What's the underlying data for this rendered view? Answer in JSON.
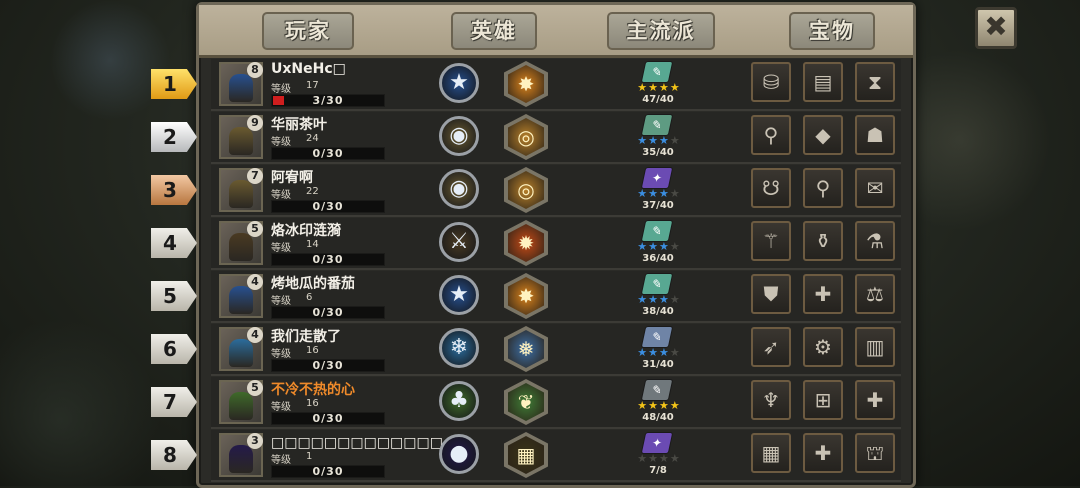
{
  "tabs": [
    "玩家",
    "英雄",
    "主流派",
    "宝物"
  ],
  "close_label": "✖",
  "level_label": "等级",
  "rows": [
    {
      "rank": "1",
      "rank_style": "gold",
      "name": "UxNeHc□",
      "name_color": "white",
      "avatar_level": "8",
      "level": "17",
      "progress": "3/30",
      "progress_ratio": 0.1,
      "faction_icon": "star-icon",
      "faction_color": "#27508f",
      "faction_glyph": "★",
      "hero_icon": "radiant-burst-icon",
      "hero_color": "#d9821c",
      "hero_glyph": "✸",
      "book_color": "#58a892",
      "book_glyph": "✎",
      "stars": 4,
      "star_color": "gold",
      "count": "47/40",
      "treasures": [
        {
          "name": "witch-hat-icon",
          "glyph": "⛁"
        },
        {
          "name": "card-icon",
          "glyph": "▤"
        },
        {
          "name": "hourglass-icon",
          "glyph": "⧗"
        }
      ]
    },
    {
      "rank": "2",
      "rank_style": "silver",
      "name": "华丽茶叶",
      "name_color": "white",
      "avatar_level": "9",
      "level": "24",
      "progress": "0/30",
      "progress_ratio": 0,
      "faction_icon": "coin-icon",
      "faction_color": "#6a5a30",
      "faction_glyph": "◉",
      "hero_icon": "gold-coin-icon",
      "hero_color": "#b7802a",
      "hero_glyph": "◎",
      "book_color": "#5e9b82",
      "book_glyph": "✎",
      "stars": 3,
      "star_color": "blue",
      "count": "35/40",
      "treasures": [
        {
          "name": "telescope-icon",
          "glyph": "⚲"
        },
        {
          "name": "crystal-icon",
          "glyph": "◆"
        },
        {
          "name": "dark-helmet-icon",
          "glyph": "☗"
        }
      ]
    },
    {
      "rank": "3",
      "rank_style": "bronze",
      "name": "阿宥啊",
      "name_color": "white",
      "avatar_level": "7",
      "level": "22",
      "progress": "0/30",
      "progress_ratio": 0,
      "faction_icon": "coin-icon",
      "faction_color": "#6a5a30",
      "faction_glyph": "◉",
      "hero_icon": "gold-coin-icon",
      "hero_color": "#b7802a",
      "hero_glyph": "◎",
      "book_color": "#6b4bb3",
      "book_glyph": "✦",
      "stars": 3,
      "star_color": "blue",
      "count": "37/40",
      "treasures": [
        {
          "name": "red-beast-icon",
          "glyph": "☋"
        },
        {
          "name": "telescope-icon",
          "glyph": "⚲"
        },
        {
          "name": "scroll-icon",
          "glyph": "✉"
        }
      ]
    },
    {
      "rank": "4",
      "rank_style": "plain",
      "name": "烙冰印涟漪",
      "name_color": "white",
      "avatar_level": "5",
      "level": "14",
      "progress": "0/30",
      "progress_ratio": 0,
      "faction_icon": "crossed-blades-icon",
      "faction_color": "#4a3a22",
      "faction_glyph": "⚔",
      "hero_icon": "flame-icon",
      "hero_color": "#c44a16",
      "hero_glyph": "✹",
      "book_color": "#58a892",
      "book_glyph": "✎",
      "stars": 3,
      "star_color": "blue",
      "count": "36/40",
      "treasures": [
        {
          "name": "broom-icon",
          "glyph": "⚚"
        },
        {
          "name": "potion-icon",
          "glyph": "⚱"
        },
        {
          "name": "flask-icon",
          "glyph": "⚗"
        }
      ]
    },
    {
      "rank": "5",
      "rank_style": "plain",
      "name": "烤地瓜的番茄",
      "name_color": "white",
      "avatar_level": "4",
      "level": "6",
      "progress": "0/30",
      "progress_ratio": 0,
      "faction_icon": "star-icon",
      "faction_color": "#27508f",
      "faction_glyph": "★",
      "hero_icon": "radiant-burst-icon",
      "hero_color": "#d9821c",
      "hero_glyph": "✸",
      "book_color": "#58a892",
      "book_glyph": "✎",
      "stars": 3,
      "star_color": "blue",
      "count": "38/40",
      "treasures": [
        {
          "name": "armor-icon",
          "glyph": "⛊"
        },
        {
          "name": "medkit-icon",
          "glyph": "✚"
        },
        {
          "name": "scales-icon",
          "glyph": "⚖"
        }
      ]
    },
    {
      "rank": "6",
      "rank_style": "plain",
      "name": "我们走散了",
      "name_color": "white",
      "avatar_level": "4",
      "level": "16",
      "progress": "0/30",
      "progress_ratio": 0,
      "faction_icon": "frost-icon",
      "faction_color": "#2b6c9c",
      "faction_glyph": "❄",
      "hero_icon": "ice-shard-icon",
      "hero_color": "#3c6fa6",
      "hero_glyph": "❅",
      "book_color": "#6f84a6",
      "book_glyph": "✎",
      "stars": 3,
      "star_color": "blue",
      "count": "31/40",
      "treasures": [
        {
          "name": "spear-icon",
          "glyph": "➶"
        },
        {
          "name": "gear-icon",
          "glyph": "⚙"
        },
        {
          "name": "spellbook-icon",
          "glyph": "▥"
        }
      ]
    },
    {
      "rank": "7",
      "rank_style": "plain",
      "name": "不冷不热的心",
      "name_color": "orange",
      "avatar_level": "5",
      "level": "16",
      "progress": "0/30",
      "progress_ratio": 0,
      "faction_icon": "nature-icon",
      "faction_color": "#3f6a2a",
      "faction_glyph": "♣",
      "hero_icon": "leaf-icon",
      "hero_color": "#3f7c36",
      "hero_glyph": "❦",
      "book_color": "#70787c",
      "book_glyph": "✎",
      "stars": 4,
      "star_color": "gold",
      "count": "48/40",
      "treasures": [
        {
          "name": "goblet-icon",
          "glyph": "♆"
        },
        {
          "name": "gift-box-icon",
          "glyph": "⊞"
        },
        {
          "name": "medkit-icon",
          "glyph": "✚"
        }
      ]
    },
    {
      "rank": "8",
      "rank_style": "plain",
      "name": "□□□□□□□□□□□□□、",
      "name_color": "white",
      "avatar_level": "3",
      "level": "1",
      "progress": "0/30",
      "progress_ratio": 0,
      "faction_icon": "dark-orb-icon",
      "faction_color": "#241a4a",
      "faction_glyph": "●",
      "hero_icon": "dark-portal-icon",
      "hero_color": "#3a3418",
      "hero_glyph": "▦",
      "book_color": "#6b4bb3",
      "book_glyph": "✦",
      "stars": 3,
      "star_color": "gray",
      "count": "7/8",
      "treasures": [
        {
          "name": "tome-icon",
          "glyph": "▦"
        },
        {
          "name": "medkit-icon",
          "glyph": "✚"
        },
        {
          "name": "cannon-icon",
          "glyph": "⛫"
        }
      ]
    }
  ]
}
